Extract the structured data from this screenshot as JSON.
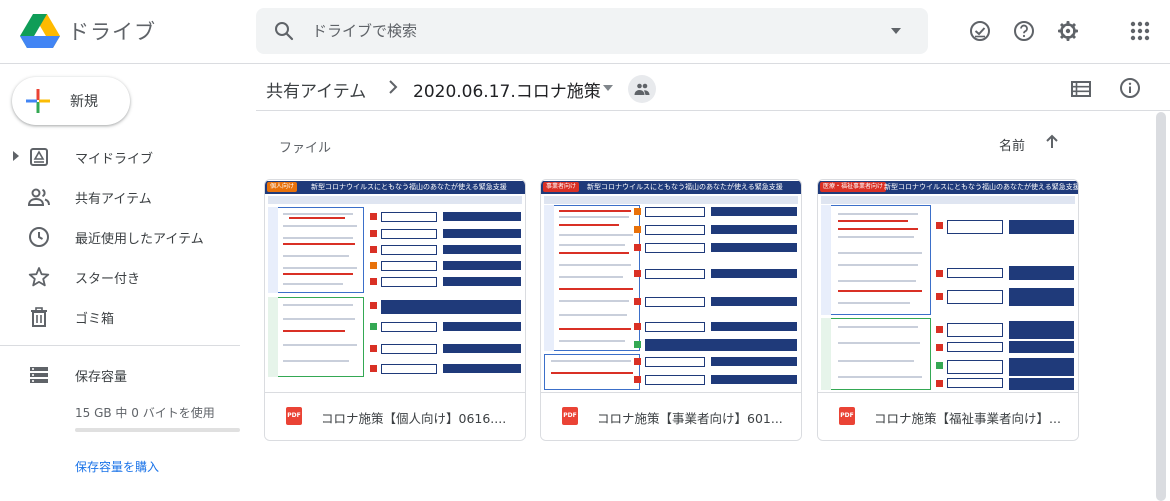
{
  "app": {
    "name": "ドライブ"
  },
  "search": {
    "placeholder": "ドライブで検索"
  },
  "header_icons": [
    "offline-ready-icon",
    "help-icon",
    "settings-icon",
    "apps-icon"
  ],
  "sidebar": {
    "new_label": "新規",
    "items": [
      {
        "label": "マイドライブ",
        "icon": "drive-icon"
      },
      {
        "label": "共有アイテム",
        "icon": "shared-people-icon"
      },
      {
        "label": "最近使用したアイテム",
        "icon": "clock-icon"
      },
      {
        "label": "スター付き",
        "icon": "star-icon"
      },
      {
        "label": "ゴミ箱",
        "icon": "trash-icon"
      }
    ],
    "storage": {
      "label": "保存容量",
      "usage": "15 GB 中 0 バイトを使用",
      "used_fraction": 0,
      "buy": "保存容量を購入"
    }
  },
  "breadcrumb": {
    "root": "共有アイテム",
    "current": "2020.06.17.コロナ施策"
  },
  "main": {
    "section": "ファイル",
    "sort_label": "名前",
    "files": [
      {
        "name": "コロナ施策【個人向け】0616....",
        "type": "PDF",
        "thumb_tag": "個人向け",
        "thumb_tag_color": "#e8710a",
        "thumb_title": "新型コロナウイルスにともなう福山のあなたが使える緊急支援"
      },
      {
        "name": "コロナ施策【事業者向け】601...",
        "type": "PDF",
        "thumb_tag": "事業者向け",
        "thumb_tag_color": "#d93025",
        "thumb_title": "新型コロナウイルスにともなう福山のあなたが使える緊急支援"
      },
      {
        "name": "コロナ施策【福祉事業者向け】...",
        "type": "PDF",
        "thumb_tag": "医療・福祉事業者向け",
        "thumb_tag_color": "#d93025",
        "thumb_title": "新型コロナウイルスにともなう福山のあなたが使える緊急支援"
      }
    ]
  },
  "colors": {
    "accent": "#1a73e8",
    "doc_navy": "#1f3a7a",
    "pdf_red": "#ea4335"
  }
}
